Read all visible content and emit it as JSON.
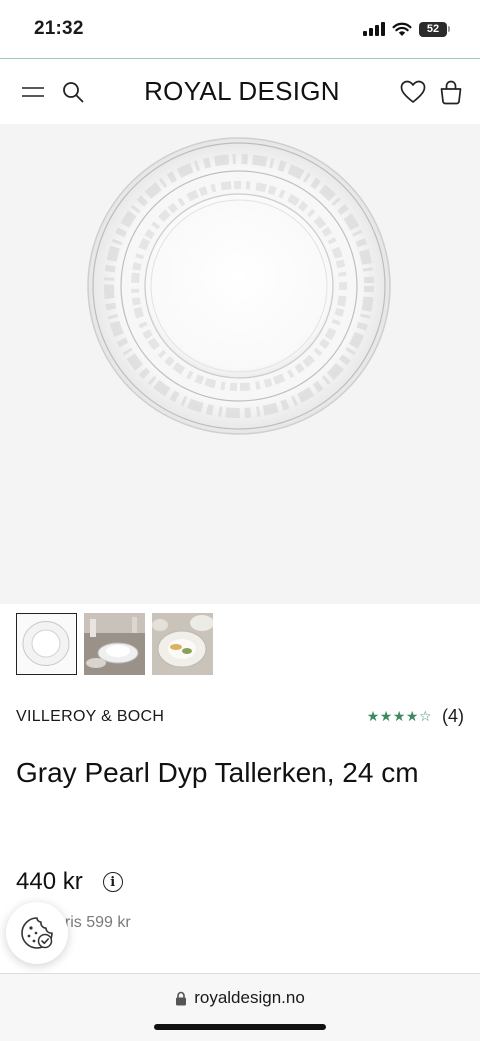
{
  "status_bar": {
    "time": "21:32",
    "battery": "52"
  },
  "header": {
    "logo": "ROYAL DESIGN"
  },
  "product": {
    "brand": "VILLEROY & BOCH",
    "rating_stars": "★★★★☆",
    "rating": 4,
    "review_count": "(4)",
    "title": "Gray Pearl Dyp Tallerken, 24 cm",
    "price": "440 kr",
    "original_price": "pris 599 kr"
  },
  "browser": {
    "url": "royaldesign.no"
  },
  "colors": {
    "accent_green": "#3c8a5f",
    "header_border": "#9fc9c0",
    "hero_bg": "#f4f4f4"
  },
  "icons": [
    "menu-icon",
    "search-icon",
    "heart-icon",
    "bag-icon",
    "info-icon",
    "cookie-icon",
    "lock-icon"
  ]
}
